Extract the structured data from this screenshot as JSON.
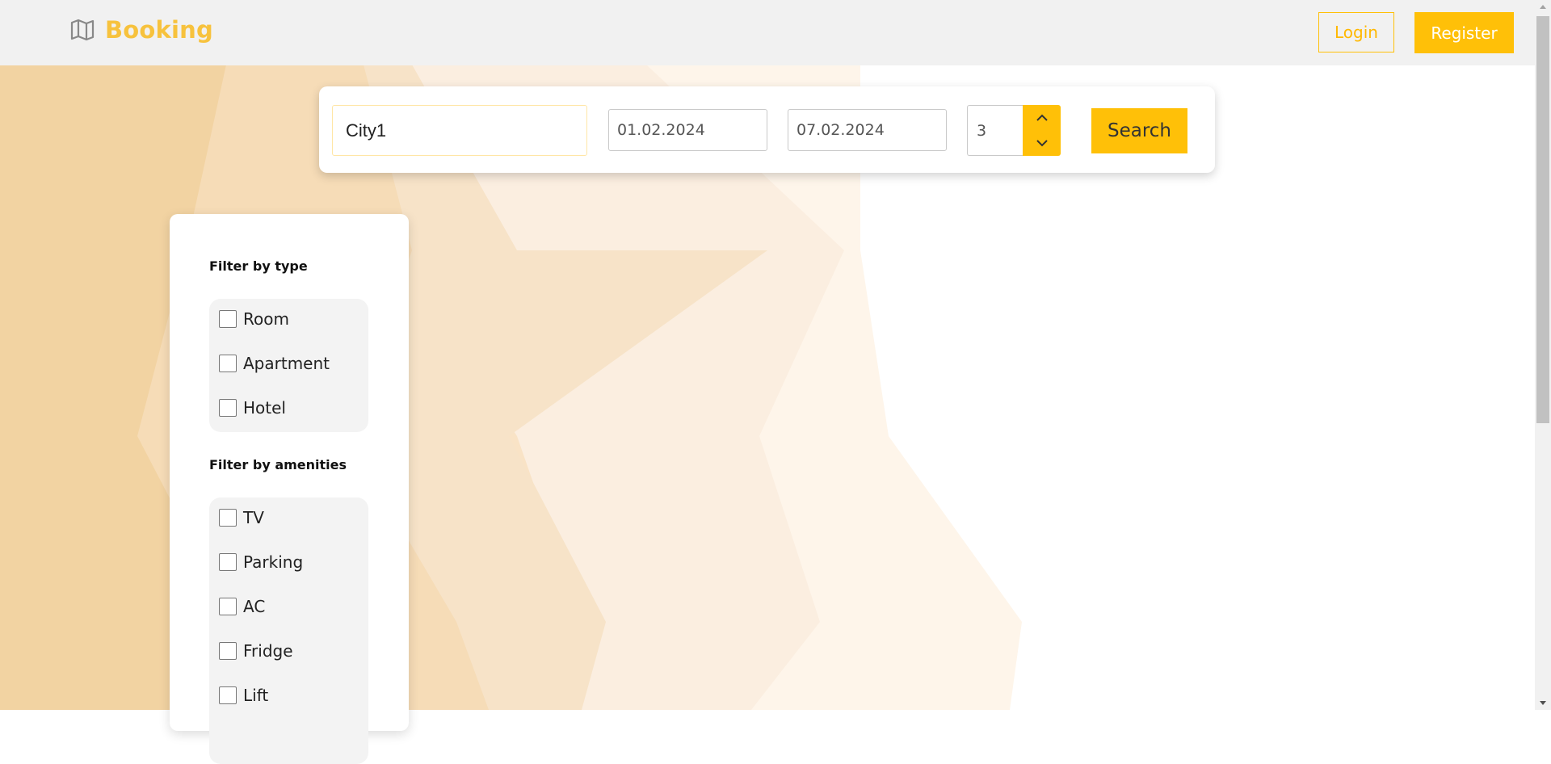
{
  "header": {
    "brand_name": "Booking",
    "brand_icon": "map-icon",
    "login_label": "Login",
    "register_label": "Register"
  },
  "search": {
    "city_value": "City1",
    "checkin_value": "01.02.2024",
    "checkout_value": "07.02.2024",
    "guests_value": "3",
    "stepper_up_icon": "chevron-up-icon",
    "stepper_down_icon": "chevron-down-icon",
    "search_label": "Search"
  },
  "filters": {
    "type_heading": "Filter by type",
    "types": [
      "Room",
      "Apartment",
      "Hotel"
    ],
    "amenities_heading": "Filter by amenities",
    "amenities": [
      "TV",
      "Parking",
      "AC",
      "Fridge",
      "Lift"
    ]
  },
  "colors": {
    "accent": "#ffc008",
    "brand_text": "#f7c23d",
    "header_bg": "#f1f1f1"
  }
}
